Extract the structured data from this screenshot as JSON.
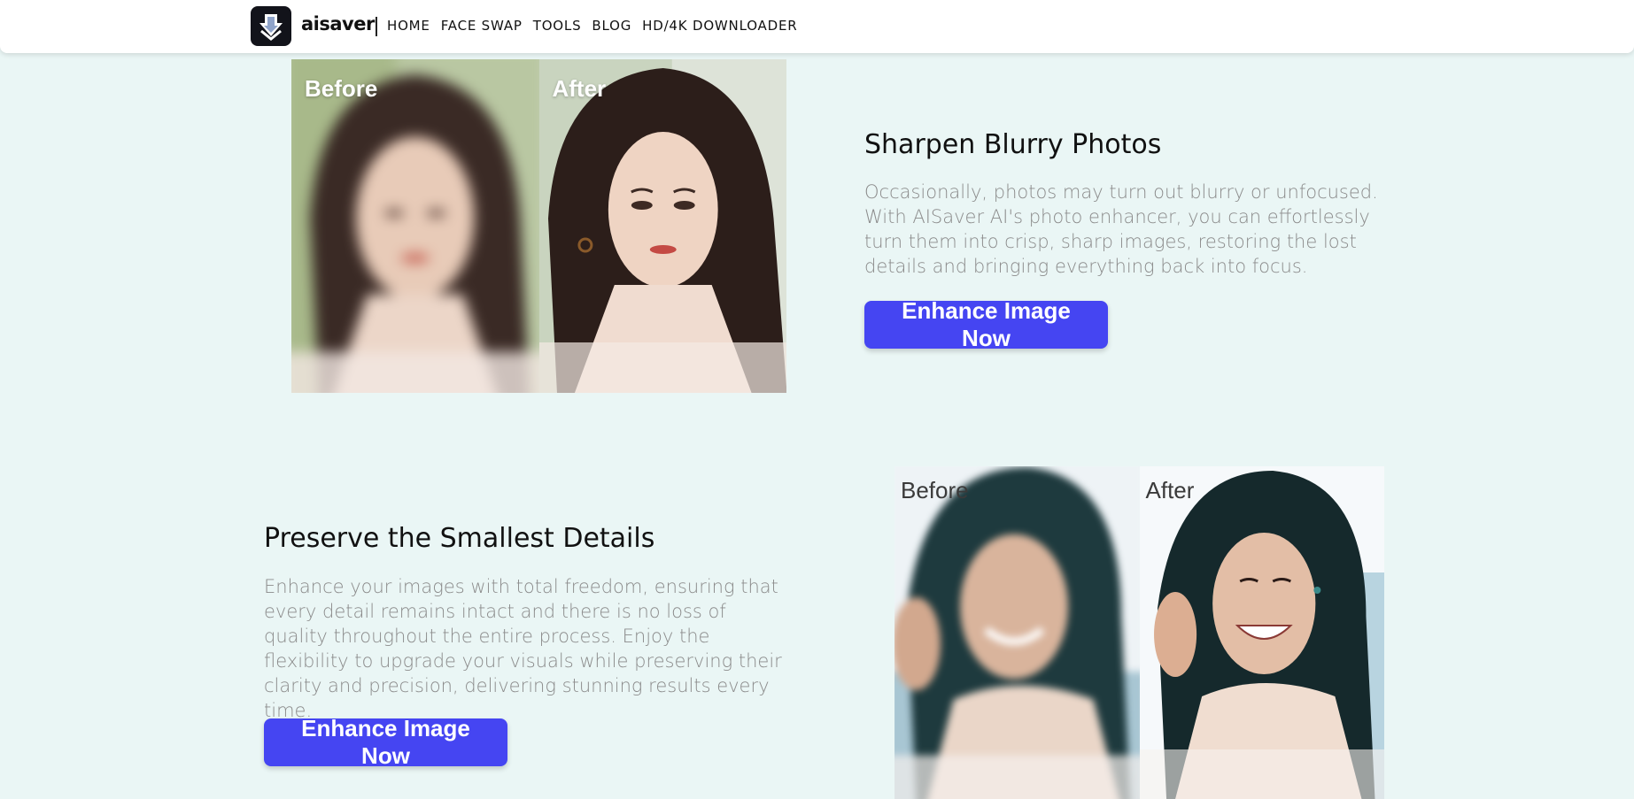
{
  "header": {
    "brand": "aisaver",
    "nav": [
      "HOME",
      "FACE SWAP",
      "TOOLS",
      "BLOG",
      "HD/4K DOWNLOADER"
    ]
  },
  "section1": {
    "before_label": "Before",
    "after_label": "After",
    "title": "Sharpen Blurry Photos",
    "description": "Occasionally, photos may turn out blurry or unfocused. With AISaver AI's photo enhancer, you can effortlessly turn them into crisp, sharp images, restoring the lost details and bringing everything back into focus.",
    "button": "Enhance Image Now"
  },
  "section2": {
    "before_label": "Before",
    "after_label": "After",
    "title": "Preserve the Smallest Details",
    "description": "Enhance your images with total freedom, ensuring that every detail remains intact and there is no loss of quality throughout the entire process. Enjoy the flexibility to upgrade your visuals while preserving their clarity and precision, delivering stunning results every time.",
    "button": "Enhance Image Now"
  },
  "colors": {
    "background": "#eaf6f5",
    "button": "#4545f2",
    "title": "#111111",
    "paragraph": "#8b8b8b"
  }
}
